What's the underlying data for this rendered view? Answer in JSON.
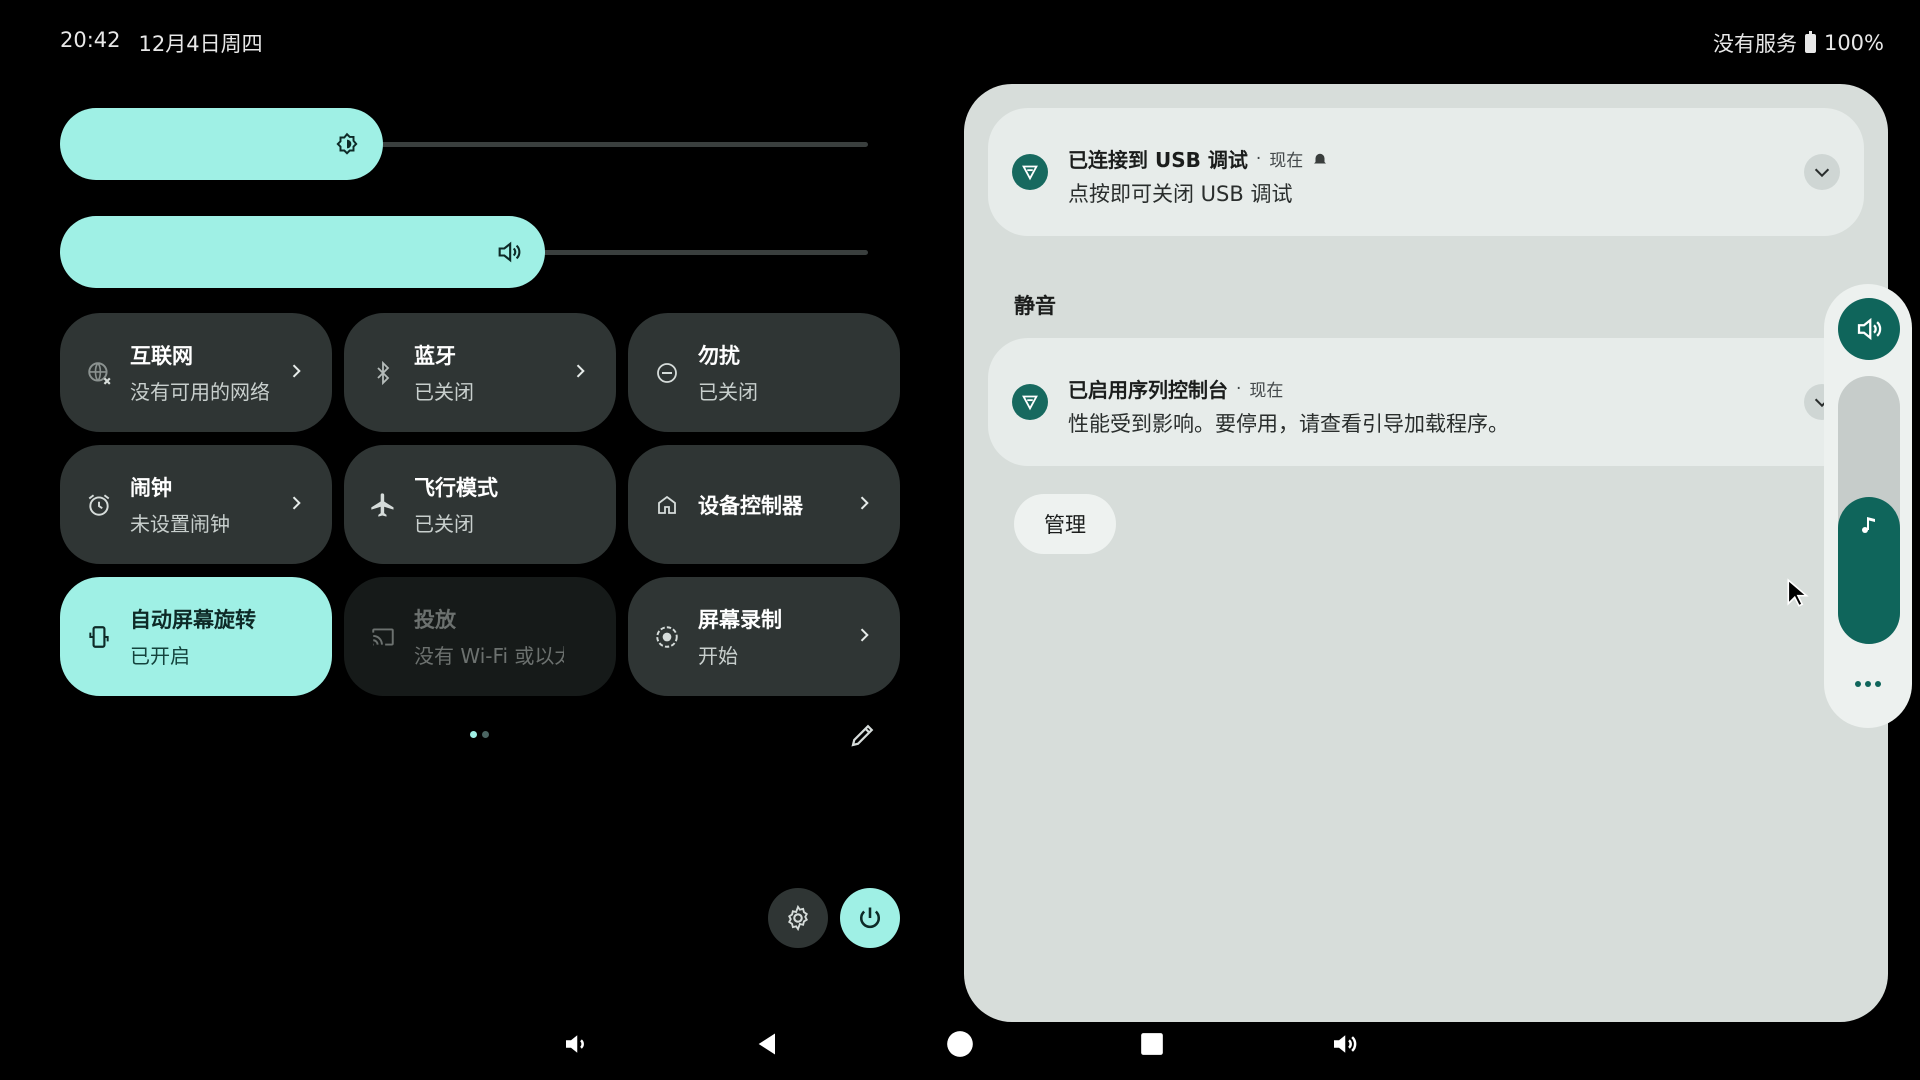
{
  "status_bar": {
    "time": "20:42",
    "date": "12月4日周四",
    "network": "没有服务",
    "battery": "100%"
  },
  "sliders": {
    "brightness": {
      "icon": "brightness-icon",
      "level": 0.4
    },
    "volume": {
      "icon": "speaker-icon",
      "level": 0.6
    }
  },
  "tiles": {
    "internet": {
      "title": "互联网",
      "subtitle": "没有可用的网络",
      "icon": "globe-off-icon"
    },
    "bluetooth": {
      "title": "蓝牙",
      "subtitle": "已关闭",
      "icon": "bluetooth-icon"
    },
    "dnd": {
      "title": "勿扰",
      "subtitle": "已关闭",
      "icon": "dnd-icon"
    },
    "alarm": {
      "title": "闹钟",
      "subtitle": "未设置闹钟",
      "icon": "alarm-icon"
    },
    "airplane": {
      "title": "飞行模式",
      "subtitle": "已关闭",
      "icon": "airplane-icon"
    },
    "device_controls": {
      "title": "设备控制器",
      "icon": "home-icon"
    },
    "auto_rotate": {
      "title": "自动屏幕旋转",
      "subtitle": "已开启",
      "icon": "rotate-icon"
    },
    "cast": {
      "title": "投放",
      "subtitle": "没有 Wi-Fi 或以太网",
      "icon": "cast-icon"
    },
    "screen_record": {
      "title": "屏幕录制",
      "subtitle": "开始",
      "icon": "record-icon"
    }
  },
  "pager": {
    "pages": 2,
    "current": 1
  },
  "notifications": {
    "usb": {
      "title": "已连接到 USB 调试",
      "separator": "·",
      "time": "现在",
      "text": "点按即可关闭 USB 调试"
    },
    "silent_label": "静音",
    "sequencer": {
      "title": "已启用序列控制台",
      "separator": "·",
      "time": "现在",
      "text": "性能受到影响。要停用，请查看引导加载程序。"
    },
    "manage_label": "管理"
  },
  "volume_panel": {
    "music_level": 0.55
  },
  "colors": {
    "accent": "#9ff0e5",
    "tile_bg": "#2f3534",
    "panel_bg": "#d7ddda",
    "teal_dark": "#0f655b"
  }
}
